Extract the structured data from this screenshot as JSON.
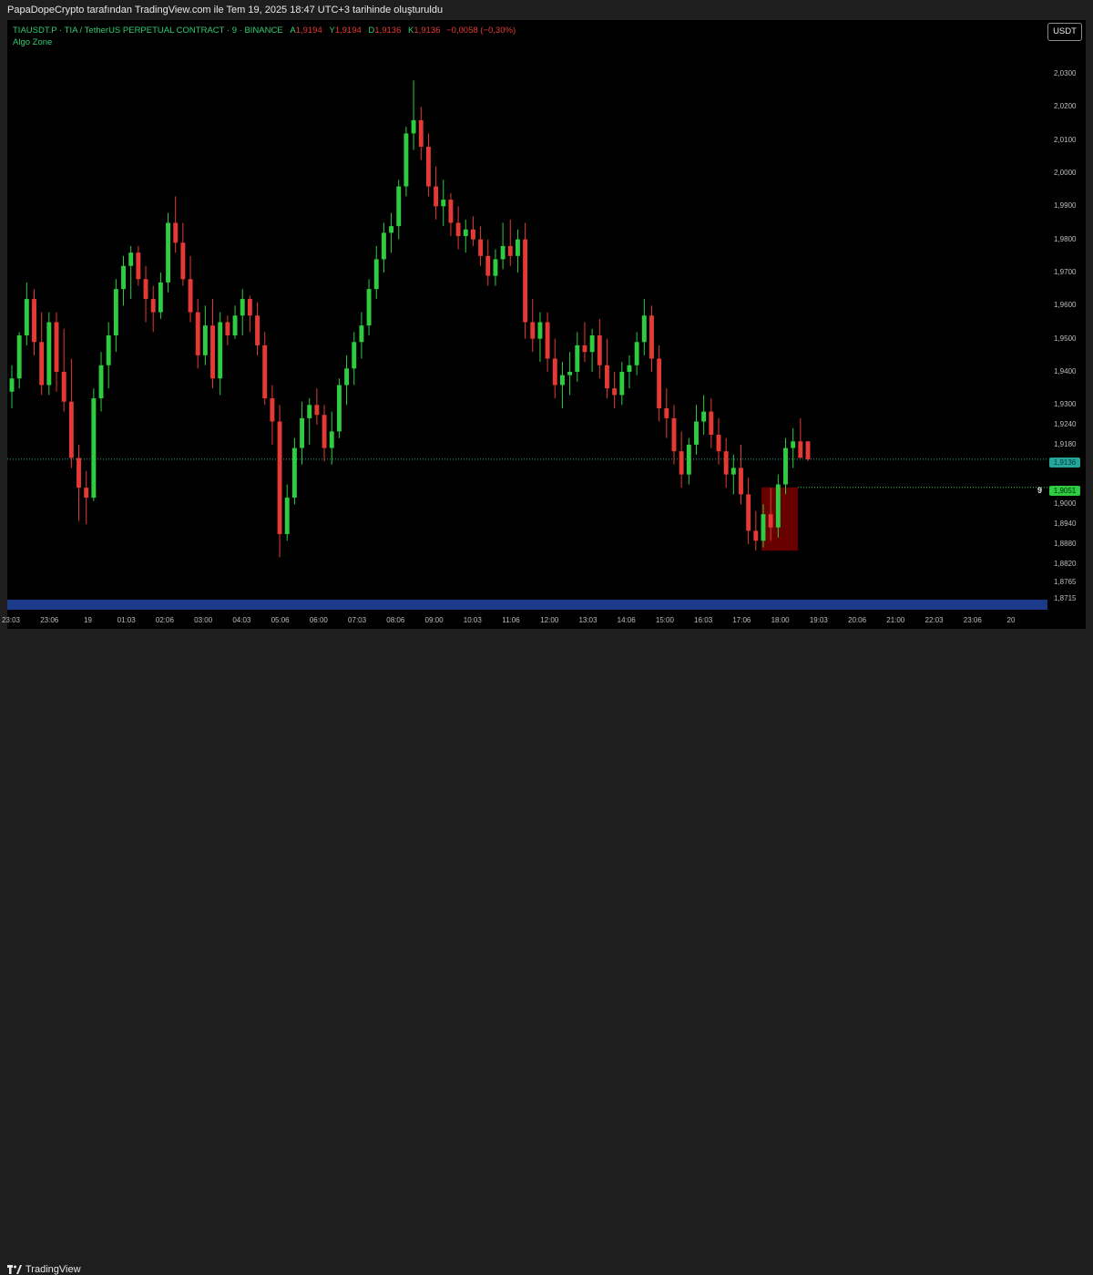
{
  "header": {
    "attribution": "PapaDopeCrypto tarafından TradingView.com ile Tem 19, 2025 18:47 UTC+3 tarihinde oluşturuldu"
  },
  "legend": {
    "symbol": "TIAUSDT.P · TIA / TetherUS PERPETUAL CONTRACT · 9 · BINANCE",
    "open_label": "A",
    "open": "1,9194",
    "high_label": "Y",
    "high": "1,9194",
    "low_label": "D",
    "low": "1,9136",
    "close_label": "K",
    "close": "1,9136",
    "change": "−0,0058 (−0,30%)",
    "indicator": "Algo Zone"
  },
  "currency_button": "USDT",
  "tags": {
    "last_price": "1,9136",
    "zone_price": "1,9051",
    "zone_number": "9"
  },
  "footer": {
    "brand": "TradingView"
  },
  "colors": {
    "up": "#2ecc40",
    "down": "#e53935",
    "background": "#000000",
    "zone_fill": "#7a0000",
    "band": "#1b3a8a"
  },
  "chart_data": {
    "type": "candlestick",
    "symbol": "TIAUSDT.P",
    "interval": "9",
    "exchange": "BINANCE",
    "ylim": [
      1.87,
      2.035
    ],
    "y_ticks": [
      "2,0300",
      "2,0200",
      "2,0100",
      "2,0000",
      "1,9900",
      "1,9800",
      "1,9700",
      "1,9600",
      "1,9500",
      "1,9400",
      "1,9300",
      "1,9240",
      "1,9180",
      "1,9000",
      "1,8940",
      "1,8880",
      "1,8820",
      "1,8765",
      "1,8715"
    ],
    "y_tick_values": [
      2.03,
      2.02,
      2.01,
      2.0,
      1.99,
      1.98,
      1.97,
      1.96,
      1.95,
      1.94,
      1.93,
      1.924,
      1.918,
      1.9,
      1.894,
      1.888,
      1.882,
      1.8765,
      1.8715
    ],
    "x_ticks": [
      "23:03",
      "23:06",
      "19",
      "01:03",
      "02:06",
      "03:00",
      "04:03",
      "05:06",
      "06:00",
      "07:03",
      "08:06",
      "09:00",
      "10:03",
      "11:06",
      "12:00",
      "13:03",
      "14:06",
      "15:00",
      "16:03",
      "17:06",
      "18:00",
      "19:03",
      "20:06",
      "21:00",
      "22:03",
      "23:06",
      "20"
    ],
    "last_price": 1.9136,
    "zone_level": 1.9051,
    "zone_box": {
      "top": 1.9051,
      "bottom": 1.886
    },
    "candles": [
      {
        "o": 1.934,
        "h": 1.942,
        "l": 1.929,
        "c": 1.938
      },
      {
        "o": 1.938,
        "h": 1.952,
        "l": 1.935,
        "c": 1.951
      },
      {
        "o": 1.951,
        "h": 1.967,
        "l": 1.948,
        "c": 1.962
      },
      {
        "o": 1.962,
        "h": 1.965,
        "l": 1.945,
        "c": 1.949
      },
      {
        "o": 1.949,
        "h": 1.958,
        "l": 1.933,
        "c": 1.936
      },
      {
        "o": 1.936,
        "h": 1.958,
        "l": 1.933,
        "c": 1.955
      },
      {
        "o": 1.955,
        "h": 1.958,
        "l": 1.934,
        "c": 1.94
      },
      {
        "o": 1.94,
        "h": 1.953,
        "l": 1.928,
        "c": 1.931
      },
      {
        "o": 1.931,
        "h": 1.944,
        "l": 1.911,
        "c": 1.914
      },
      {
        "o": 1.914,
        "h": 1.918,
        "l": 1.895,
        "c": 1.905
      },
      {
        "o": 1.905,
        "h": 1.91,
        "l": 1.894,
        "c": 1.902
      },
      {
        "o": 1.902,
        "h": 1.935,
        "l": 1.901,
        "c": 1.932
      },
      {
        "o": 1.932,
        "h": 1.946,
        "l": 1.928,
        "c": 1.942
      },
      {
        "o": 1.942,
        "h": 1.955,
        "l": 1.935,
        "c": 1.951
      },
      {
        "o": 1.951,
        "h": 1.968,
        "l": 1.946,
        "c": 1.965
      },
      {
        "o": 1.965,
        "h": 1.975,
        "l": 1.96,
        "c": 1.972
      },
      {
        "o": 1.972,
        "h": 1.978,
        "l": 1.962,
        "c": 1.976
      },
      {
        "o": 1.976,
        "h": 1.978,
        "l": 1.966,
        "c": 1.968
      },
      {
        "o": 1.968,
        "h": 1.972,
        "l": 1.955,
        "c": 1.962
      },
      {
        "o": 1.962,
        "h": 1.966,
        "l": 1.952,
        "c": 1.958
      },
      {
        "o": 1.958,
        "h": 1.97,
        "l": 1.956,
        "c": 1.967
      },
      {
        "o": 1.967,
        "h": 1.988,
        "l": 1.964,
        "c": 1.985
      },
      {
        "o": 1.985,
        "h": 1.993,
        "l": 1.976,
        "c": 1.979
      },
      {
        "o": 1.979,
        "h": 1.985,
        "l": 1.966,
        "c": 1.968
      },
      {
        "o": 1.968,
        "h": 1.975,
        "l": 1.955,
        "c": 1.958
      },
      {
        "o": 1.958,
        "h": 1.962,
        "l": 1.941,
        "c": 1.945
      },
      {
        "o": 1.945,
        "h": 1.96,
        "l": 1.942,
        "c": 1.954
      },
      {
        "o": 1.954,
        "h": 1.962,
        "l": 1.935,
        "c": 1.938
      },
      {
        "o": 1.938,
        "h": 1.958,
        "l": 1.933,
        "c": 1.955
      },
      {
        "o": 1.955,
        "h": 1.957,
        "l": 1.948,
        "c": 1.951
      },
      {
        "o": 1.951,
        "h": 1.96,
        "l": 1.95,
        "c": 1.957
      },
      {
        "o": 1.957,
        "h": 1.965,
        "l": 1.951,
        "c": 1.962
      },
      {
        "o": 1.962,
        "h": 1.963,
        "l": 1.952,
        "c": 1.957
      },
      {
        "o": 1.957,
        "h": 1.961,
        "l": 1.945,
        "c": 1.948
      },
      {
        "o": 1.948,
        "h": 1.952,
        "l": 1.93,
        "c": 1.932
      },
      {
        "o": 1.932,
        "h": 1.936,
        "l": 1.918,
        "c": 1.925
      },
      {
        "o": 1.925,
        "h": 1.93,
        "l": 1.884,
        "c": 1.891
      },
      {
        "o": 1.891,
        "h": 1.906,
        "l": 1.889,
        "c": 1.902
      },
      {
        "o": 1.902,
        "h": 1.92,
        "l": 1.9,
        "c": 1.917
      },
      {
        "o": 1.917,
        "h": 1.931,
        "l": 1.912,
        "c": 1.926
      },
      {
        "o": 1.926,
        "h": 1.932,
        "l": 1.918,
        "c": 1.93
      },
      {
        "o": 1.93,
        "h": 1.935,
        "l": 1.924,
        "c": 1.927
      },
      {
        "o": 1.927,
        "h": 1.93,
        "l": 1.913,
        "c": 1.917
      },
      {
        "o": 1.917,
        "h": 1.928,
        "l": 1.912,
        "c": 1.922
      },
      {
        "o": 1.922,
        "h": 1.938,
        "l": 1.92,
        "c": 1.936
      },
      {
        "o": 1.936,
        "h": 1.945,
        "l": 1.93,
        "c": 1.941
      },
      {
        "o": 1.941,
        "h": 1.952,
        "l": 1.936,
        "c": 1.949
      },
      {
        "o": 1.949,
        "h": 1.958,
        "l": 1.944,
        "c": 1.954
      },
      {
        "o": 1.954,
        "h": 1.968,
        "l": 1.951,
        "c": 1.965
      },
      {
        "o": 1.965,
        "h": 1.978,
        "l": 1.962,
        "c": 1.974
      },
      {
        "o": 1.974,
        "h": 1.985,
        "l": 1.97,
        "c": 1.982
      },
      {
        "o": 1.982,
        "h": 1.988,
        "l": 1.976,
        "c": 1.984
      },
      {
        "o": 1.984,
        "h": 1.998,
        "l": 1.98,
        "c": 1.996
      },
      {
        "o": 1.996,
        "h": 2.014,
        "l": 1.993,
        "c": 2.012
      },
      {
        "o": 2.012,
        "h": 2.028,
        "l": 2.007,
        "c": 2.016
      },
      {
        "o": 2.016,
        "h": 2.02,
        "l": 2.004,
        "c": 2.008
      },
      {
        "o": 2.008,
        "h": 2.012,
        "l": 1.993,
        "c": 1.996
      },
      {
        "o": 1.996,
        "h": 2.002,
        "l": 1.986,
        "c": 1.99
      },
      {
        "o": 1.99,
        "h": 1.998,
        "l": 1.984,
        "c": 1.992
      },
      {
        "o": 1.992,
        "h": 1.994,
        "l": 1.981,
        "c": 1.985
      },
      {
        "o": 1.985,
        "h": 1.99,
        "l": 1.977,
        "c": 1.981
      },
      {
        "o": 1.981,
        "h": 1.986,
        "l": 1.976,
        "c": 1.983
      },
      {
        "o": 1.983,
        "h": 1.987,
        "l": 1.978,
        "c": 1.98
      },
      {
        "o": 1.98,
        "h": 1.984,
        "l": 1.972,
        "c": 1.975
      },
      {
        "o": 1.975,
        "h": 1.98,
        "l": 1.966,
        "c": 1.969
      },
      {
        "o": 1.969,
        "h": 1.977,
        "l": 1.966,
        "c": 1.974
      },
      {
        "o": 1.974,
        "h": 1.985,
        "l": 1.971,
        "c": 1.978
      },
      {
        "o": 1.978,
        "h": 1.986,
        "l": 1.972,
        "c": 1.975
      },
      {
        "o": 1.975,
        "h": 1.983,
        "l": 1.97,
        "c": 1.98
      },
      {
        "o": 1.98,
        "h": 1.985,
        "l": 1.95,
        "c": 1.955
      },
      {
        "o": 1.955,
        "h": 1.962,
        "l": 1.946,
        "c": 1.95
      },
      {
        "o": 1.95,
        "h": 1.958,
        "l": 1.943,
        "c": 1.955
      },
      {
        "o": 1.955,
        "h": 1.958,
        "l": 1.94,
        "c": 1.944
      },
      {
        "o": 1.944,
        "h": 1.95,
        "l": 1.932,
        "c": 1.936
      },
      {
        "o": 1.936,
        "h": 1.943,
        "l": 1.929,
        "c": 1.939
      },
      {
        "o": 1.939,
        "h": 1.946,
        "l": 1.933,
        "c": 1.94
      },
      {
        "o": 1.94,
        "h": 1.952,
        "l": 1.937,
        "c": 1.948
      },
      {
        "o": 1.948,
        "h": 1.955,
        "l": 1.943,
        "c": 1.946
      },
      {
        "o": 1.946,
        "h": 1.953,
        "l": 1.94,
        "c": 1.951
      },
      {
        "o": 1.951,
        "h": 1.956,
        "l": 1.938,
        "c": 1.942
      },
      {
        "o": 1.942,
        "h": 1.95,
        "l": 1.932,
        "c": 1.935
      },
      {
        "o": 1.935,
        "h": 1.94,
        "l": 1.929,
        "c": 1.933
      },
      {
        "o": 1.933,
        "h": 1.943,
        "l": 1.93,
        "c": 1.94
      },
      {
        "o": 1.94,
        "h": 1.945,
        "l": 1.935,
        "c": 1.942
      },
      {
        "o": 1.942,
        "h": 1.952,
        "l": 1.939,
        "c": 1.949
      },
      {
        "o": 1.949,
        "h": 1.962,
        "l": 1.945,
        "c": 1.957
      },
      {
        "o": 1.957,
        "h": 1.96,
        "l": 1.94,
        "c": 1.944
      },
      {
        "o": 1.944,
        "h": 1.948,
        "l": 1.925,
        "c": 1.929
      },
      {
        "o": 1.929,
        "h": 1.935,
        "l": 1.92,
        "c": 1.926
      },
      {
        "o": 1.926,
        "h": 1.93,
        "l": 1.912,
        "c": 1.916
      },
      {
        "o": 1.916,
        "h": 1.922,
        "l": 1.905,
        "c": 1.909
      },
      {
        "o": 1.909,
        "h": 1.92,
        "l": 1.906,
        "c": 1.918
      },
      {
        "o": 1.918,
        "h": 1.93,
        "l": 1.915,
        "c": 1.925
      },
      {
        "o": 1.925,
        "h": 1.933,
        "l": 1.921,
        "c": 1.928
      },
      {
        "o": 1.928,
        "h": 1.932,
        "l": 1.917,
        "c": 1.921
      },
      {
        "o": 1.921,
        "h": 1.926,
        "l": 1.912,
        "c": 1.916
      },
      {
        "o": 1.916,
        "h": 1.92,
        "l": 1.905,
        "c": 1.909
      },
      {
        "o": 1.909,
        "h": 1.915,
        "l": 1.903,
        "c": 1.911
      },
      {
        "o": 1.911,
        "h": 1.918,
        "l": 1.9,
        "c": 1.903
      },
      {
        "o": 1.903,
        "h": 1.908,
        "l": 1.888,
        "c": 1.892
      },
      {
        "o": 1.892,
        "h": 1.898,
        "l": 1.886,
        "c": 1.889
      },
      {
        "o": 1.889,
        "h": 1.9,
        "l": 1.887,
        "c": 1.897
      },
      {
        "o": 1.897,
        "h": 1.905,
        "l": 1.889,
        "c": 1.893
      },
      {
        "o": 1.893,
        "h": 1.909,
        "l": 1.89,
        "c": 1.906
      },
      {
        "o": 1.906,
        "h": 1.92,
        "l": 1.903,
        "c": 1.917
      },
      {
        "o": 1.917,
        "h": 1.923,
        "l": 1.911,
        "c": 1.919
      },
      {
        "o": 1.919,
        "h": 1.926,
        "l": 1.914,
        "c": 1.914
      },
      {
        "o": 1.919,
        "h": 1.919,
        "l": 1.913,
        "c": 1.9136
      }
    ]
  }
}
